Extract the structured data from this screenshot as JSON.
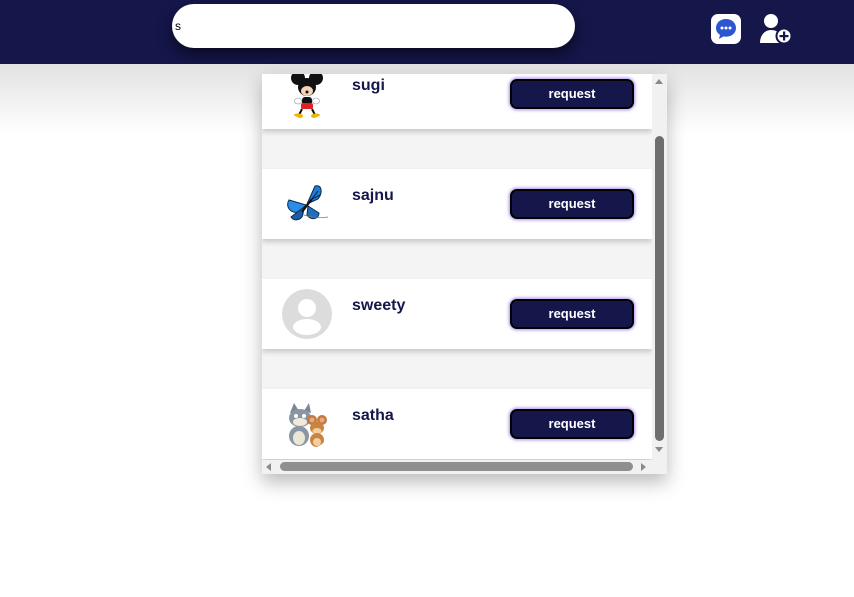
{
  "search": {
    "value": "s",
    "icon": "search-text-field"
  },
  "header": {
    "chat_icon": "chat-bubble-icon",
    "add_user_icon": "add-user-icon",
    "accent": "#15164a"
  },
  "results": [
    {
      "name": "sugi",
      "avatar_icon": "mickey-mouse-avatar",
      "button_label": "request"
    },
    {
      "name": "sajnu",
      "avatar_icon": "blue-butterfly-avatar",
      "button_label": "request"
    },
    {
      "name": "sweety",
      "avatar_icon": "default-user-avatar",
      "button_label": "request"
    },
    {
      "name": "satha",
      "avatar_icon": "tom-and-jerry-avatar",
      "button_label": "request"
    }
  ],
  "colors": {
    "button_bg": "#15164a",
    "button_glow": "#a98cf0",
    "header_bg": "#15164a"
  }
}
